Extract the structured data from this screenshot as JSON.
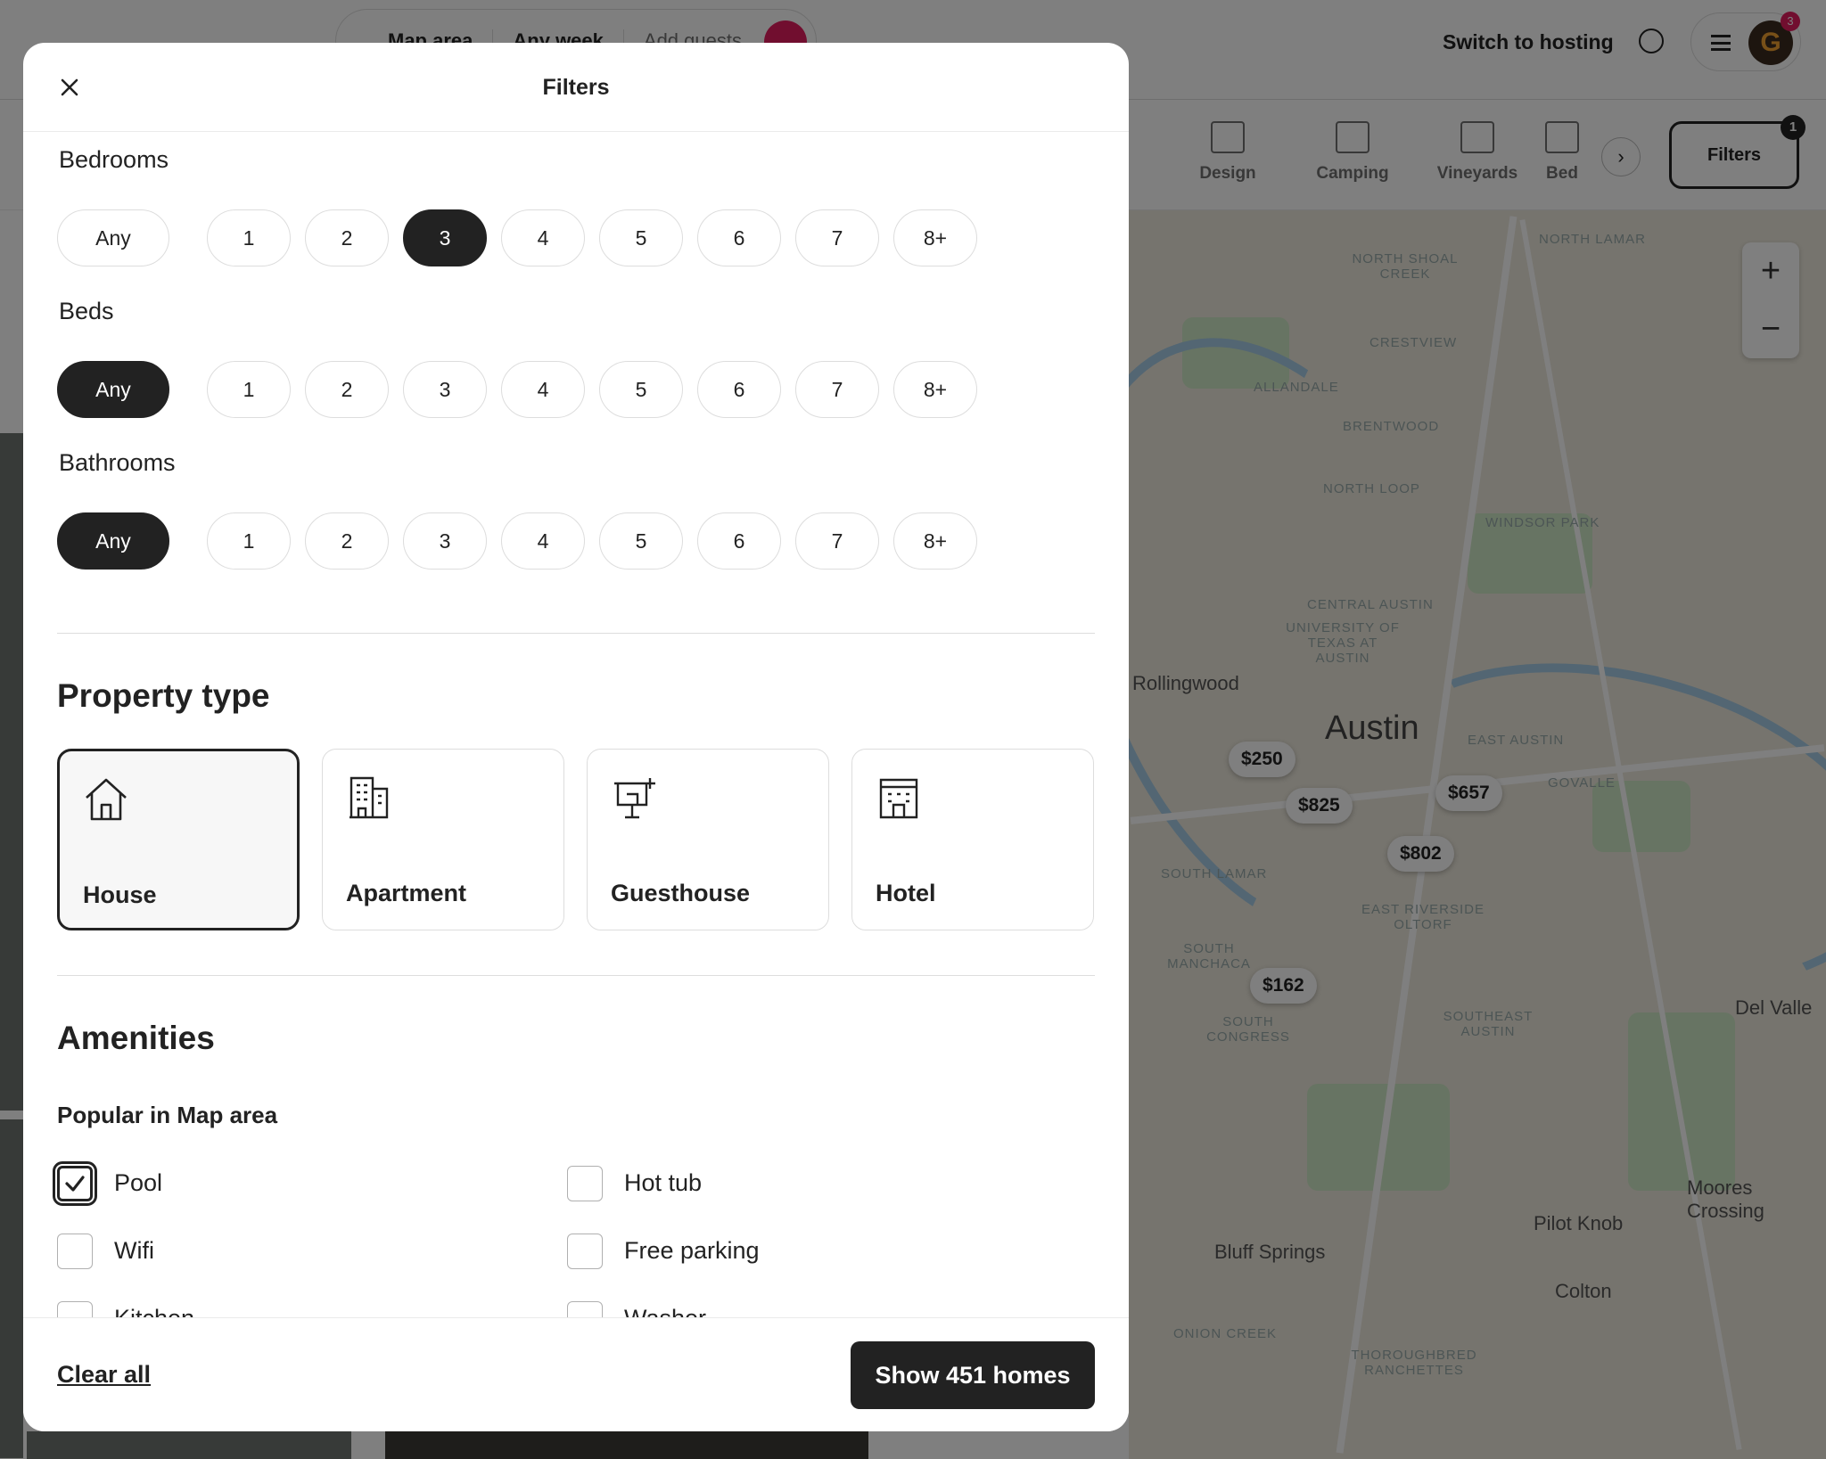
{
  "topbar": {
    "search": {
      "location": "Map area",
      "dates": "Any week",
      "guests_placeholder": "Add guests"
    },
    "switch_hosting": "Switch to hosting",
    "avatar_letter": "G",
    "notification_count": "3"
  },
  "categories": [
    {
      "label": "Design",
      "icon": "design-icon"
    },
    {
      "label": "Camping",
      "icon": "tent-icon"
    },
    {
      "label": "Vineyards",
      "icon": "grapes-icon"
    },
    {
      "label": "Bed",
      "icon": "bed-icon"
    }
  ],
  "filters_button": {
    "label": "Filters",
    "count": "1"
  },
  "map": {
    "cities": [
      "Austin",
      "Rollingwood",
      "Bluff Springs",
      "Pilot Knob",
      "Colton",
      "Del Valle",
      "Moores Crossing"
    ],
    "neighborhoods": [
      "NORTH LAMAR",
      "NORTH SHOAL CREEK",
      "CRESTVIEW",
      "ALLANDALE",
      "BRENTWOOD",
      "NORTH LOOP",
      "WINDSOR PARK",
      "CENTRAL AUSTIN",
      "UNIVERSITY OF TEXAS AT AUSTIN",
      "EAST AUSTIN",
      "GOVALLE",
      "SOUTH LAMAR",
      "EAST RIVERSIDE OLTORF",
      "SOUTH MANCHACA",
      "SOUTH CONGRESS",
      "SOUTHEAST AUSTIN",
      "ONION CREEK",
      "THOROUGHBRED RANCHETTES"
    ],
    "price_pins": [
      "$250",
      "$825",
      "$657",
      "$802",
      "$162"
    ]
  },
  "modal": {
    "title": "Filters",
    "rooms": [
      {
        "label": "Bedrooms",
        "options": [
          "Any",
          "1",
          "2",
          "3",
          "4",
          "5",
          "6",
          "7",
          "8+"
        ],
        "selected": "3"
      },
      {
        "label": "Beds",
        "options": [
          "Any",
          "1",
          "2",
          "3",
          "4",
          "5",
          "6",
          "7",
          "8+"
        ],
        "selected": "Any"
      },
      {
        "label": "Bathrooms",
        "options": [
          "Any",
          "1",
          "2",
          "3",
          "4",
          "5",
          "6",
          "7",
          "8+"
        ],
        "selected": "Any"
      }
    ],
    "property_type": {
      "title": "Property type",
      "options": [
        {
          "label": "House",
          "icon": "house-icon",
          "selected": true
        },
        {
          "label": "Apartment",
          "icon": "apartment-icon",
          "selected": false
        },
        {
          "label": "Guesthouse",
          "icon": "guesthouse-icon",
          "selected": false
        },
        {
          "label": "Hotel",
          "icon": "hotel-icon",
          "selected": false
        }
      ]
    },
    "amenities": {
      "title": "Amenities",
      "group": "Popular in Map area",
      "items": [
        {
          "label": "Pool",
          "checked": true
        },
        {
          "label": "Hot tub",
          "checked": false
        },
        {
          "label": "Wifi",
          "checked": false
        },
        {
          "label": "Free parking",
          "checked": false
        },
        {
          "label": "Kitchen",
          "checked": false
        },
        {
          "label": "Washer",
          "checked": false
        }
      ]
    },
    "footer": {
      "clear": "Clear all",
      "show": "Show 451 homes"
    }
  }
}
